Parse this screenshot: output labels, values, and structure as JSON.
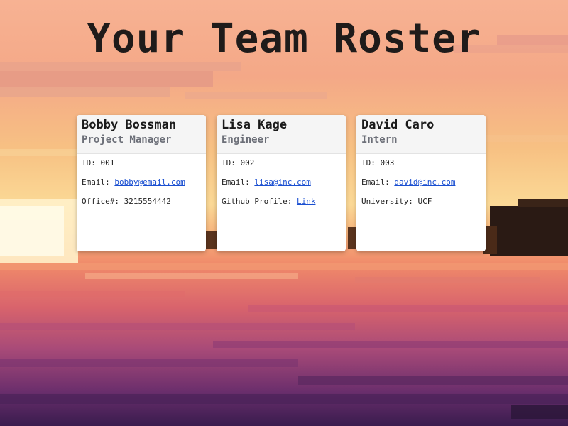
{
  "page": {
    "title": "Your Team Roster"
  },
  "cards": [
    {
      "name": "Bobby Bossman",
      "role": "Project Manager",
      "id_label": "ID: ",
      "id": "001",
      "email_label": "Email: ",
      "email": "bobby@email.com",
      "extra_label": "Office#: ",
      "extra_value": "3215554442"
    },
    {
      "name": "Lisa Kage",
      "role": "Engineer",
      "id_label": "ID: ",
      "id": "002",
      "email_label": "Email: ",
      "email": "lisa@inc.com",
      "extra_label": "Github Profile: ",
      "extra_value": "Link"
    },
    {
      "name": "David Caro",
      "role": "Intern",
      "id_label": "ID: ",
      "id": "003",
      "email_label": "Email: ",
      "email": "david@inc.com",
      "extra_label": "University: ",
      "extra_value": "UCF"
    }
  ],
  "colors": {
    "title": "#1f1b1a",
    "link": "#1a4fd1",
    "card_header_bg": "#f5f5f5",
    "role_text": "#6c6f78"
  }
}
